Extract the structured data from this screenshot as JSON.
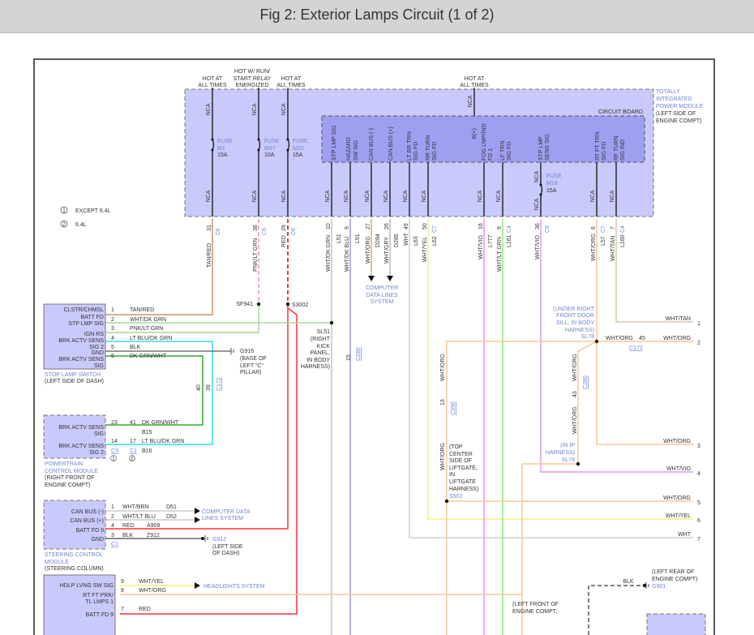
{
  "title": "Fig 2: Exterior Lamps Circuit (1 of 2)",
  "nca": "NCA",
  "legend": [
    {
      "mark": "1",
      "text": "EXCEPT 6.4L"
    },
    {
      "mark": "2",
      "text": "6.4L"
    }
  ],
  "power_sources": [
    "HOT AT",
    "ALL TIMES",
    "HOT W/ RUN/",
    "START RELAY",
    "ENERGIZED"
  ],
  "tipm": {
    "name": [
      "TOTALLY",
      "INTEGRATED",
      "POWER MODULE",
      "(LEFT SIDE OF",
      "ENGINE COMPT)"
    ],
    "circuit_board": "CIRCUIT BOARD",
    "bplus": "B(+)",
    "fuses": [
      {
        "label": "FUSE",
        "id": "M1",
        "rating": "15A"
      },
      {
        "label": "FUSE",
        "id": "M37",
        "rating": "10A"
      },
      {
        "label": "FUSE",
        "id": "M20",
        "rating": "15A"
      },
      {
        "label": "FUSE",
        "id": "M18",
        "rating": "15A"
      }
    ],
    "columns": [
      {
        "pin": "31",
        "conn": "C6",
        "wire": "TAN/RED"
      },
      {
        "pin": "38",
        "conn": "C5",
        "wire": "PNK/LT GRN"
      },
      {
        "pin": "29",
        "conn": "C6",
        "wire": "RED"
      },
      {
        "f1": "STP LMP SIG",
        "pin": "10",
        "wire": "WHT/DK GRN",
        "circuit": "L51"
      },
      {
        "f1": "HAZARD",
        "f2": "SW SIG",
        "pin": "9",
        "wire": "WHT/DK BLU",
        "circuit": "L91"
      },
      {
        "f1": "CAN BUS (-)",
        "pin": "27",
        "wire": "WHT/ORG",
        "circuit": "D284"
      },
      {
        "f1": "CAN BUS (+)",
        "pin": "26",
        "wire": "WHT/GRY",
        "circuit": "D285"
      },
      {
        "f1": "LT RR TRN",
        "f2": "SIG FD",
        "pin": "49",
        "wire": "WHT",
        "circuit": "L63"
      },
      {
        "f1": "RR TURN",
        "f2": "SIG FD",
        "pin": "50",
        "conn": "C7",
        "wire": "WHT/YEL",
        "circuit": "L62"
      },
      {
        "f1": "FOG LMP/IND",
        "f2": "FD 1",
        "pin": "16",
        "wire": "WHT/VIO",
        "circuit": "L777"
      },
      {
        "f1": "LF TRN",
        "f2": "SIG FD",
        "pin": "9",
        "conn": "C4",
        "wire": "WHT/LT GRN",
        "circuit": "L161"
      },
      {
        "f1": "STP LMP",
        "f2": "SENS SIG",
        "pin": "36",
        "conn": "C5",
        "wire": "WHT/VIO"
      },
      {
        "f1": "RT FT TRN",
        "f2": "SIG FD",
        "pin": "6",
        "conn": "C7",
        "wire": "WHT/ORG",
        "circuit": "L57"
      },
      {
        "f1": "RF TURN",
        "f2": "SIG IND",
        "pin": "7",
        "conn": "C4",
        "wire": "WHT/TAN",
        "circuit": "L160"
      }
    ]
  },
  "splices": {
    "sf941": "SF941",
    "s3002": "S3002",
    "sl51": {
      "id": "SL51",
      "loc": [
        "(RIGHT",
        "KICK",
        "PANEL,",
        "IN BODY",
        "HARNESS)"
      ]
    },
    "sl78a": {
      "id": "SL78",
      "loc": [
        "(UNDER RIGHT",
        "FRONT DOOR",
        "SILL, IN BODY",
        "HARNESS)"
      ]
    },
    "sl78b": {
      "id": "SL78",
      "loc": [
        "(IN IP",
        "HARNESS)"
      ]
    },
    "s502": {
      "id": "S502",
      "loc": [
        "(TOP",
        "CENTER",
        "SIDE OF",
        "LIFTGATE,",
        "IN",
        "LIFTGATE",
        "HARNESS)"
      ]
    }
  },
  "connectors": {
    "c280": "C280",
    "c172": "C172",
    "c390": "C390",
    "pin15": "15",
    "pin45": "45",
    "pin13": "13",
    "pin43": "43",
    "pin40": "40",
    "pin39": "39",
    "wht_org": "WHT/ORG"
  },
  "computer_data": [
    "COMPUTER",
    "DATA LINES",
    "SYSTEM"
  ],
  "stop_lamp_switch": {
    "pins": [
      "CLSTR/CHMSL",
      "BATT FD",
      "STP LMP SIG",
      "IGN RS",
      "BRK ACTV SENS",
      "SIG 2",
      "GND",
      "BRK ACTV SENS",
      "SIG"
    ],
    "wires": [
      {
        "pin": "1",
        "color": "TAN/RED"
      },
      {
        "pin": "2",
        "color": "WHT/DK GRN"
      },
      {
        "pin": "3",
        "color": "PNK/LT GRN"
      },
      {
        "pin": "4",
        "color": "LT BLU/DK GRN"
      },
      {
        "pin": "5",
        "color": "BLK"
      },
      {
        "pin": "6",
        "color": "DK GRN/WHT"
      }
    ],
    "name": [
      "STOP LAMP SWITCH",
      "(LEFT SIDE OF DASH)"
    ],
    "ground": {
      "id": "G916",
      "loc": [
        "(BASE OF",
        "LEFT \"C\"",
        "PILLAR)"
      ]
    }
  },
  "pcm": {
    "pins": [
      "BRK ACTV SENS",
      "SIG",
      "BRK ACTV SENS",
      "SIG 2"
    ],
    "rows": [
      {
        "pin": "23",
        "pin2": "41",
        "color": "DK GRN/WHT",
        "circuit": "B15"
      },
      {
        "pin": "14",
        "pin2": "17",
        "color": "LT BLU/DK GRN",
        "circuit": "B16"
      }
    ],
    "conns": [
      "C3",
      "C1"
    ],
    "name": [
      "POWERTRAIN",
      "CONTROL MODULE",
      "(RIGHT FRONT OF",
      "ENGINE COMPT)"
    ]
  },
  "scm": {
    "pins": [
      "CAN BUS (-)",
      "CAN BUS (+)",
      "BATT FD 9",
      "GND"
    ],
    "rows": [
      {
        "pin": "1",
        "color": "WHT/BRN",
        "circuit": "D51"
      },
      {
        "pin": "2",
        "color": "WHT/LT BLU",
        "circuit": "D52"
      },
      {
        "pin": "4",
        "color": "RED",
        "circuit": "A909"
      },
      {
        "pin": "3",
        "color": "BLK",
        "circuit": "Z912"
      }
    ],
    "conn": "C1",
    "data_lines": [
      "COMPUTER DATA",
      "LINES SYSTEM"
    ],
    "ground": {
      "id": "G912",
      "loc": [
        "(LEFT SIDE",
        "OF DASH)"
      ]
    },
    "name": [
      "STEERING CONTROL",
      "MODULE",
      "(STEERING COLUMN)"
    ]
  },
  "lower_module": {
    "pins": [
      "HDLP LVNG SW SIG",
      "RT FT PRK/",
      "TL LMPS 1",
      "BATT FD 9"
    ],
    "rows": [
      {
        "pin": "9",
        "color": "WHT/YEL"
      },
      {
        "pin": "8",
        "color": "WHT/ORG"
      },
      {
        "pin": "7",
        "color": "RED"
      }
    ],
    "headlights": "HEADLIGHTS SYSTEM"
  },
  "right_outputs": [
    {
      "n": "1",
      "color": "WHT/TAN"
    },
    {
      "n": "2",
      "color": "WHT/ORG"
    },
    {
      "n": "3",
      "color": "WHT/ORG"
    },
    {
      "n": "4",
      "color": "WHT/VIO"
    },
    {
      "n": "5",
      "color": "WHT/ORG"
    },
    {
      "n": "6",
      "color": "WHT/YEL"
    },
    {
      "n": "7",
      "color": "WHT"
    }
  ],
  "g901": {
    "id": "G901",
    "wire": "BLK",
    "loc": [
      "(LEFT REAR OF",
      "ENGINE COMPT)"
    ]
  },
  "left_front": [
    "(LEFT FRONT OF",
    "ENGINE COMPT,"
  ],
  "colors": {
    "module": "#c9c9fb",
    "board": "#9f9ff2",
    "label_blue": "#6f86d0",
    "red": "#ff3333",
    "org": "#f5c89a"
  }
}
